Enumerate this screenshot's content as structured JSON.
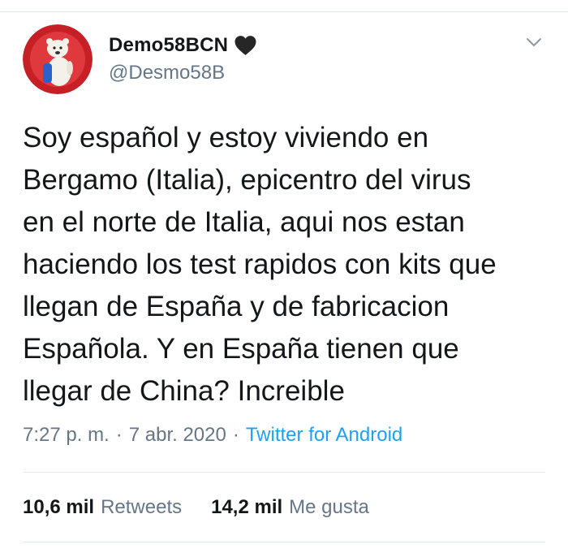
{
  "tweet": {
    "display_name": "Demo58BCN",
    "handle": "@Desmo58B",
    "text": "Soy español y estoy viviendo en\nBergamo (Italia), epicentro del virus\nen el norte de Italia, aqui nos estan\nhaciendo los test rapidos con kits que\nllegan de España y de fabricacion\nEspañola. Y en España tienen que\nllegar de China? Increible",
    "time": "7:27 p. m.",
    "separator": "·",
    "date": "7 abr. 2020",
    "source": "Twitter for Android",
    "retweets_count": "10,6 mil",
    "retweets_label": "Retweets",
    "likes_count": "14,2 mil",
    "likes_label": "Me gusta"
  },
  "icons": {
    "name_emoji": "black-heart-icon",
    "menu": "chevron-down-icon",
    "avatar": "polar-bear-mascot-avatar"
  },
  "colors": {
    "text": "#14171a",
    "secondary": "#657786",
    "link": "#1da1f2",
    "divider": "#e1e8ed",
    "avatar_bg": "#c62026"
  }
}
